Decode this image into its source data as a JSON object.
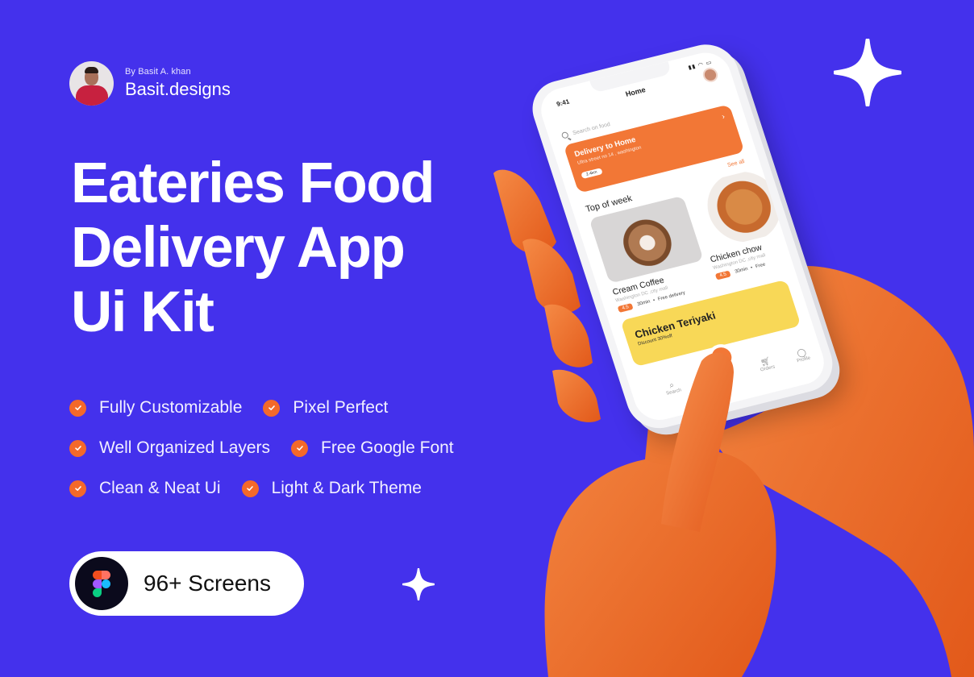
{
  "colors": {
    "background": "#4431EC",
    "accent_orange": "#F4692A",
    "promo_yellow": "#F8D857",
    "white": "#FFFFFF"
  },
  "author": {
    "byline": "By Basit A. khan",
    "name": "Basit.designs"
  },
  "headline": {
    "lines": [
      "Eateries Food",
      "Delivery App",
      "Ui Kit"
    ]
  },
  "features": [
    [
      "Fully Customizable",
      "Pixel Perfect"
    ],
    [
      "Well Organized Layers",
      "Free Google Font"
    ],
    [
      "Clean & Neat Ui",
      "Light & Dark Theme"
    ]
  ],
  "screens_badge": {
    "label": "96+ Screens",
    "icon": "figma-icon"
  },
  "phone": {
    "status_time": "9:41",
    "status_icons": "signal wifi battery",
    "title": "Home",
    "search_placeholder": "Search on food",
    "delivery": {
      "title": "Delivery to Home",
      "address": "Ultra street no 14 , washington",
      "distance": "2.4km"
    },
    "section": {
      "title": "Top of week",
      "see_all": "See all"
    },
    "foods": [
      {
        "name": "Cream Coffee",
        "location": "Washington DC ,city mall",
        "rating": "4.5",
        "time": "30min",
        "delivery": "Free delivery"
      },
      {
        "name": "Chicken chow",
        "location": "Washington DC ,city mall",
        "rating": "4.5",
        "time": "30min",
        "delivery": "Free"
      }
    ],
    "promo": {
      "title": "Chicken Teriyaki",
      "subtitle": "Discount 30%off"
    },
    "nav": {
      "search": "Search",
      "orders": "Orders",
      "profile": "Profile"
    }
  }
}
